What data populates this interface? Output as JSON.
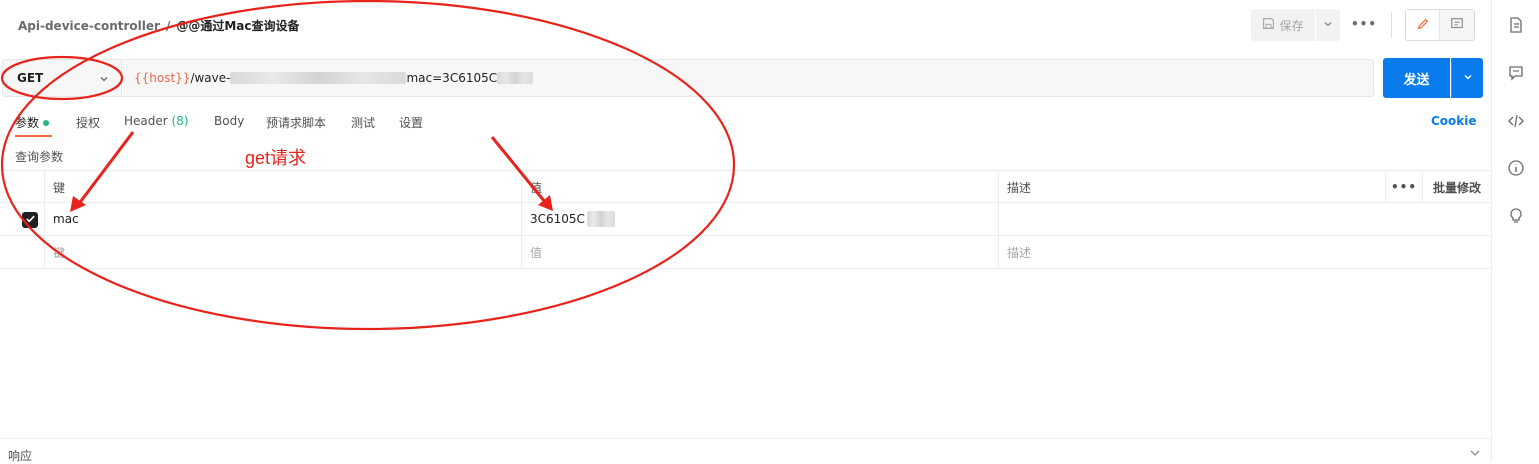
{
  "header": {
    "breadcrumb_parent": "Api-device-controller",
    "breadcrumb_sep": "/",
    "breadcrumb_current": "@@通过Mac查询设备",
    "save_label": "保存",
    "more_label": "•••"
  },
  "request": {
    "method": "GET",
    "url_var": "{{host}}",
    "url_prefix": "/wave-",
    "url_suffix": "mac=3C6105C",
    "send_label": "发送"
  },
  "tabs": [
    {
      "label": "参数"
    },
    {
      "label": "授权"
    },
    {
      "label": "Header",
      "count": "(8)"
    },
    {
      "label": "Body"
    },
    {
      "label": "预请求脚本"
    },
    {
      "label": "测试"
    },
    {
      "label": "设置"
    }
  ],
  "cookie_label": "Cookie",
  "query_title": "查询参数",
  "table": {
    "headers": {
      "key": "键",
      "value": "值",
      "desc": "描述",
      "more": "•••",
      "bulk": "批量修改"
    },
    "rows": [
      {
        "key": "mac",
        "value": "3C6105C",
        "checked": true
      }
    ],
    "placeholders": {
      "key": "键",
      "value": "值",
      "desc": "描述"
    }
  },
  "response_label": "响应",
  "annotation_text": "get请求",
  "colors": {
    "accent": "#097bed",
    "active_tab": "#f26b3a",
    "annotation": "#e8231b",
    "env_var": "#e8684a"
  }
}
